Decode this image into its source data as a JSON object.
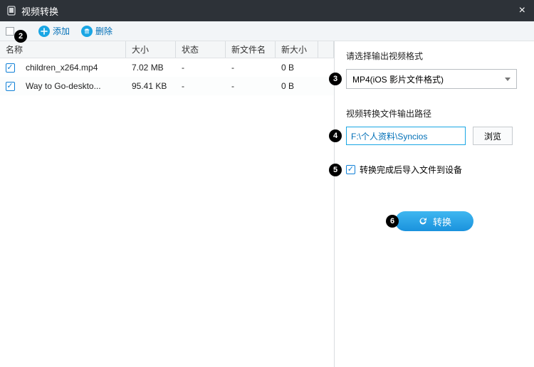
{
  "titlebar": {
    "title": "视频转换"
  },
  "toolbar": {
    "add_label": "添加",
    "delete_label": "删除"
  },
  "table": {
    "headers": {
      "name": "名称",
      "size": "大小",
      "state": "状态",
      "new_name": "新文件名",
      "new_size": "新大小"
    },
    "rows": [
      {
        "checked": true,
        "name": "children_x264.mp4",
        "size": "7.02 MB",
        "state": "-",
        "new_name": "-",
        "new_size": "0 B"
      },
      {
        "checked": true,
        "name": "Way to Go-deskto...",
        "size": "95.41 KB",
        "state": "-",
        "new_name": "-",
        "new_size": "0 B"
      }
    ]
  },
  "right": {
    "format_label": "请选择输出视频格式",
    "format_selected": "MP4(iOS 影片文件格式)",
    "path_label": "视频转换文件输出路径",
    "path_value": "F:\\个人资料\\Syncios",
    "browse_label": "浏览",
    "import_checkbox_label": "转换完成后导入文件到设备",
    "convert_label": "转换"
  },
  "badges": {
    "b2": "2",
    "b3": "3",
    "b4": "4",
    "b5": "5",
    "b6": "6"
  }
}
